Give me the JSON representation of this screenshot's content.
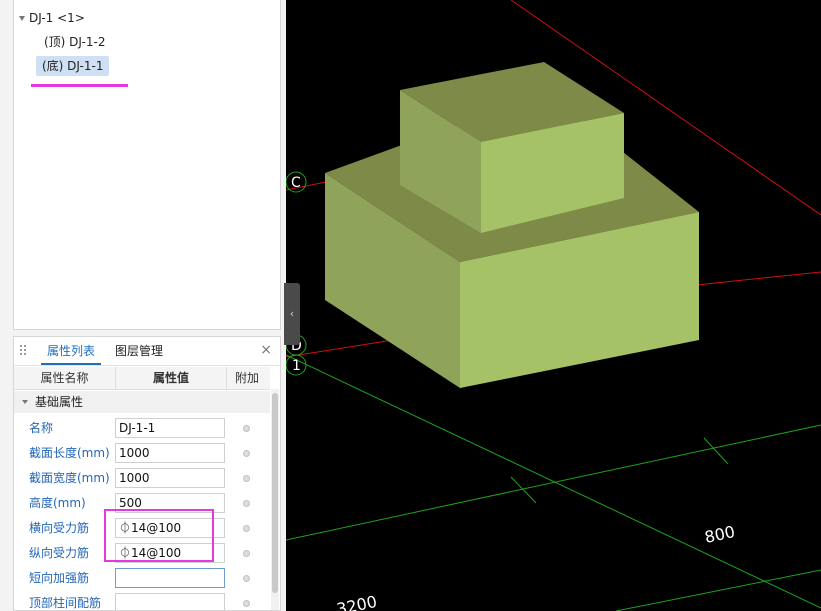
{
  "tree": {
    "root_label": "DJ-1 <1>",
    "children": [
      {
        "label": "(顶) DJ-1-2",
        "selected": false
      },
      {
        "label": "(底) DJ-1-1",
        "selected": true
      }
    ]
  },
  "panel": {
    "tabs": [
      {
        "label": "属性列表",
        "active": true
      },
      {
        "label": "图层管理",
        "active": false
      }
    ],
    "close_label": "×",
    "columns": [
      "属性名称",
      "属性值",
      "附加"
    ],
    "section_label": "基础属性",
    "rows": [
      {
        "label": "名称",
        "value": ""
      },
      {
        "label": "截面长度(mm)",
        "value": "1000"
      },
      {
        "label": "截面宽度(mm)",
        "value": "1000"
      },
      {
        "label": "高度(mm)",
        "value": "500"
      },
      {
        "label": "横向受力筋",
        "value": "⏀14@100"
      },
      {
        "label": "纵向受力筋",
        "value": "⏀14@100"
      },
      {
        "label": "短向加强筋",
        "value": ""
      },
      {
        "label": "顶部柱间配筋",
        "value": ""
      }
    ]
  },
  "name_value": "DJ-1-1",
  "viewport": {
    "axis_labels": [
      "C",
      "D",
      "1"
    ],
    "dimension_labels": [
      "800",
      "3200"
    ],
    "collapse_icon": "‹",
    "colors": {
      "block_top": "#7e8a47",
      "block_front": "#a6c266",
      "block_side": "#8fa35a",
      "grid_green": "#1fa21f",
      "grid_red": "#d01010"
    }
  }
}
